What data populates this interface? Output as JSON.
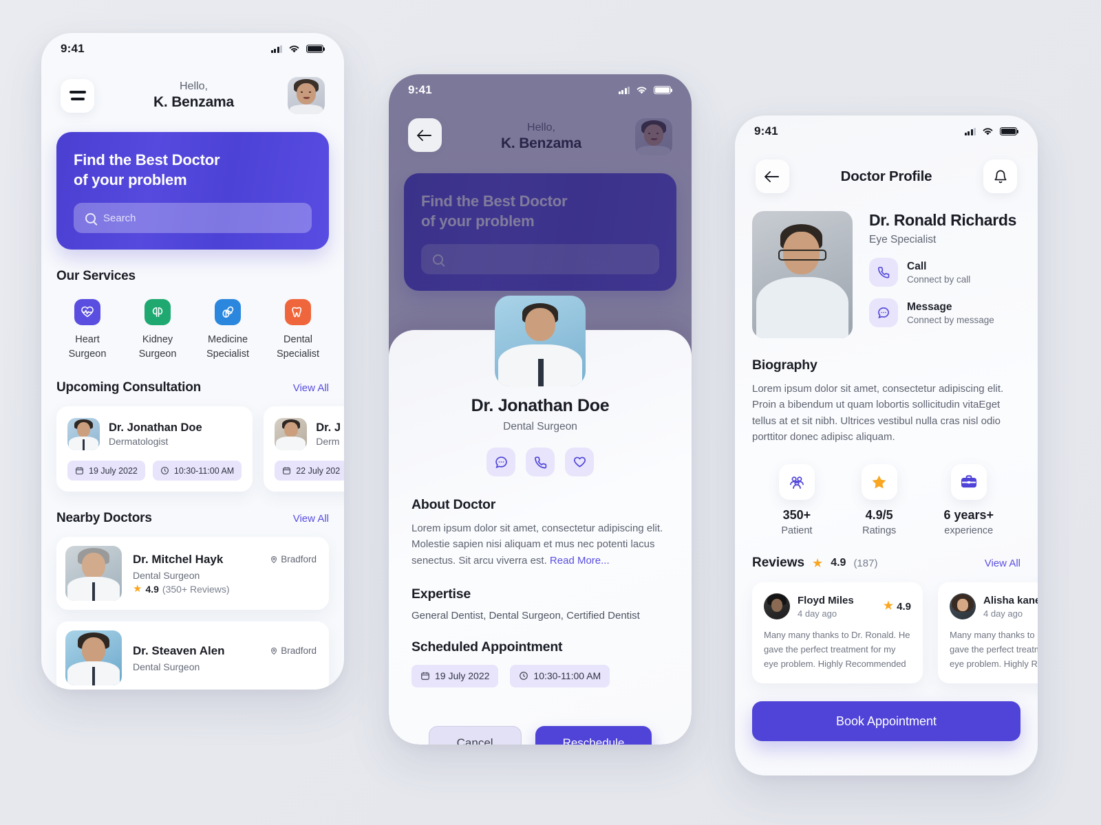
{
  "statusbar": {
    "time": "9:41"
  },
  "home": {
    "greeting": "Hello,",
    "user_name": "K. Benzama",
    "hero_title": "Find the Best Doctor\nof your problem",
    "search_placeholder": "Search",
    "services_title": "Our Services",
    "services": [
      {
        "label": "Heart\nSurgeon",
        "icon": "heart-pulse-icon",
        "color": "#5a4ee0"
      },
      {
        "label": "Kidney\nSurgeon",
        "icon": "kidney-icon",
        "color": "#1fa971"
      },
      {
        "label": "Medicine\nSpecialist",
        "icon": "pills-icon",
        "color": "#2b87dd"
      },
      {
        "label": "Dental\nSpecialist",
        "icon": "tooth-icon",
        "color": "#f0663c"
      }
    ],
    "upcoming_title": "Upcoming Consultation",
    "view_all": "View All",
    "upcoming": [
      {
        "name": "Dr. Jonathan Doe",
        "specialty": "Dermatologist",
        "date": "19 July 2022",
        "time": "10:30-11:00 AM"
      },
      {
        "name": "Dr. J",
        "specialty": "Derm",
        "date": "22 July 202",
        "time": ""
      }
    ],
    "nearby_title": "Nearby Doctors",
    "nearby_view_all": "View All",
    "nearby": [
      {
        "name": "Dr. Mitchel Hayk",
        "location": "Bradford",
        "specialty": "Dental Surgeon",
        "rating": "4.9",
        "reviews": "(350+ Reviews)"
      },
      {
        "name": "Dr. Steaven Alen",
        "location": "Bradford",
        "specialty": "Dental Surgeon",
        "rating": "",
        "reviews": ""
      }
    ]
  },
  "detail": {
    "greeting": "Hello,",
    "user_name": "K. Benzama",
    "bg_hero_title": "Find the Best Doctor\nof your problem",
    "doctor_name": "Dr. Jonathan Doe",
    "doctor_role": "Dental Surgeon",
    "actions": [
      "message-icon",
      "phone-icon",
      "heart-icon"
    ],
    "about_title": "About Doctor",
    "about_body": "Lorem ipsum dolor sit amet, consectetur adipiscing elit. Molestie sapien nisi aliquam et mus nec potenti lacus senectus. Sit arcu viverra est. ",
    "read_more": "Read More...",
    "expertise_title": "Expertise",
    "expertise": "General Dentist,  Dental Surgeon,  Certified Dentist",
    "scheduled_title": "Scheduled Appointment",
    "scheduled_date": "19 July 2022",
    "scheduled_time": "10:30-11:00 AM",
    "cancel_label": "Cancel",
    "reschedule_label": "Reschedule"
  },
  "profile": {
    "title": "Doctor Profile",
    "doctor_name": "Dr. Ronald Richards",
    "doctor_role": "Eye Specialist",
    "contacts": [
      {
        "title": "Call",
        "subtitle": "Connect by call",
        "icon": "phone-icon"
      },
      {
        "title": "Message",
        "subtitle": "Connect by message",
        "icon": "message-icon"
      }
    ],
    "bio_title": "Biography",
    "bio_body": "Lorem ipsum dolor sit amet, consectetur adipiscing elit. Proin a bibendum ut quam lobortis sollicitudin vitaEget tellus at et sit nibh. Ultrices vestibul nulla cras nisl odio porttitor donec adipisc aliquam.",
    "stats": [
      {
        "value": "350+",
        "label": "Patient",
        "icon": "patients-icon"
      },
      {
        "value": "4.9/5",
        "label": "Ratings",
        "icon": "star-icon"
      },
      {
        "value": "6 years+",
        "label": "experience",
        "icon": "briefcase-icon"
      }
    ],
    "reviews_title": "Reviews",
    "reviews_score": "4.9",
    "reviews_count": "(187)",
    "reviews_view_all": "View All",
    "reviews": [
      {
        "name": "Floyd Miles",
        "date": "4 day ago",
        "rating": "4.9",
        "body": "Many many thanks to Dr. Ronald. He gave the perfect treatment for my eye problem. Highly Recommended"
      },
      {
        "name": "Alisha kane",
        "date": "4 day ago",
        "rating": "",
        "body": "Many many thanks to Dr. Ronald. He gave the perfect treatment for my eye problem. Highly Recommended"
      }
    ],
    "book_label": "Book Appointment"
  },
  "colors": {
    "primary": "#4f43d8",
    "accent_light": "#e7e4fb",
    "star": "#f9a620",
    "link": "#5a4ee0"
  }
}
